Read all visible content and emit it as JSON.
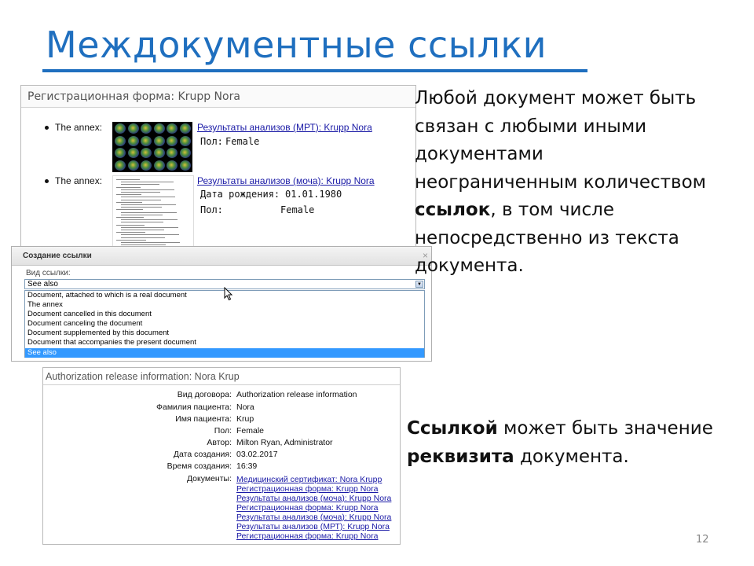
{
  "slide": {
    "title": "Междокументные ссылки",
    "page_number": "12",
    "text_block_1": {
      "line1": "Любой документ может быть",
      "line2": "связан с любыми иными",
      "line3": "документами",
      "line4": "неограниченным количеством",
      "line5_bold": "ссылок",
      "line5_rest": ", в том числе",
      "line6": "непосредственно из текста",
      "line7": "документа."
    },
    "text_block_2": {
      "bold1": "Ссылкой",
      "rest1": " может быть значение",
      "bold2": "реквизита",
      "rest2": " документа."
    }
  },
  "registration_form": {
    "header": "Регистрационная форма: Krupp Nora",
    "annexes": [
      {
        "label": "The annex:",
        "link": "Результаты анализов (МРТ): Krupp Nora",
        "fields": [
          {
            "label": "Пол:",
            "value": "Female"
          }
        ]
      },
      {
        "label": "The annex:",
        "link": "Результаты анализов (моча): Krupp Nora",
        "fields": [
          {
            "label": "Дата рождения:",
            "value": "01.01.1980"
          },
          {
            "label": "Пол:",
            "value": "Female"
          }
        ]
      }
    ]
  },
  "create_link_dialog": {
    "title": "Создание ссылки",
    "close": "×",
    "kind_label": "Вид ссылки:",
    "selected": "See also",
    "options": [
      "Document, attached to which is a real document",
      "The annex",
      "Document cancelled in this document",
      "Document canceling the document",
      "Document supplemented by this document",
      "Document that accompanies the present document",
      "See also"
    ]
  },
  "authorization_panel": {
    "header": "Authorization release information: Nora Krup",
    "rows": [
      {
        "label": "Вид договора:",
        "value": "Authorization release information"
      },
      {
        "label": "Фамилия пациента:",
        "value": "Nora"
      },
      {
        "label": "Имя пациента:",
        "value": "Krup"
      },
      {
        "label": "Пол:",
        "value": "Female"
      },
      {
        "label": "Автор:",
        "value": "Milton Ryan, Administrator"
      },
      {
        "label": "Дата создания:",
        "value": "03.02.2017"
      },
      {
        "label": "Время создания:",
        "value": "16:39"
      }
    ],
    "documents_label": "Документы:",
    "documents": [
      "Медицинский сертификат: Nora Krupp",
      "Регистрационная форма: Krupp Nora",
      "Результаты анализов (моча): Krupp Nora",
      "Регистрационная форма: Krupp Nora",
      "Результаты анализов (моча): Krupp Nora",
      "Результаты анализов (МРТ): Krupp Nora",
      "Регистрационная форма: Krupp Nora"
    ]
  }
}
